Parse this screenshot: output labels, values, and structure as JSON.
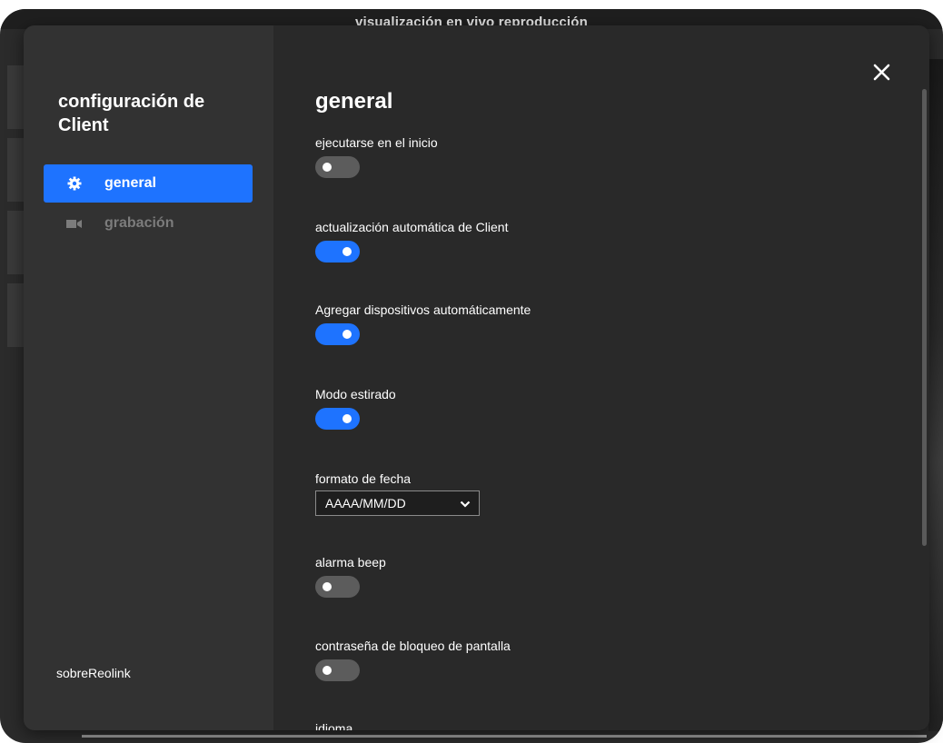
{
  "background": {
    "title": "visualización en vivo  reproducción"
  },
  "sidebar": {
    "title": "configuración de Client",
    "items": [
      {
        "label": "general",
        "icon": "gear-icon",
        "active": true
      },
      {
        "label": "grabación",
        "icon": "video-camera-icon",
        "active": false
      }
    ],
    "about_label": "sobreReolink"
  },
  "main": {
    "title": "general",
    "settings": [
      {
        "label": "ejecutarse en el inicio",
        "type": "toggle",
        "on": false
      },
      {
        "label": "actualización automática de Client",
        "type": "toggle",
        "on": true
      },
      {
        "label": "Agregar dispositivos automáticamente",
        "type": "toggle",
        "on": true
      },
      {
        "label": "Modo estirado",
        "type": "toggle",
        "on": true
      },
      {
        "label": "formato de fecha",
        "type": "select",
        "value": "AAAA/MM/DD"
      },
      {
        "label": "alarma beep",
        "type": "toggle",
        "on": false
      },
      {
        "label": "contraseña de bloqueo de pantalla",
        "type": "toggle",
        "on": false
      },
      {
        "label": "idioma",
        "type": "select"
      }
    ]
  },
  "colors": {
    "accent": "#1e73ff",
    "toggle_off": "#5c5c5c",
    "modal_bg": "#292929",
    "sidebar_bg": "#323232"
  }
}
